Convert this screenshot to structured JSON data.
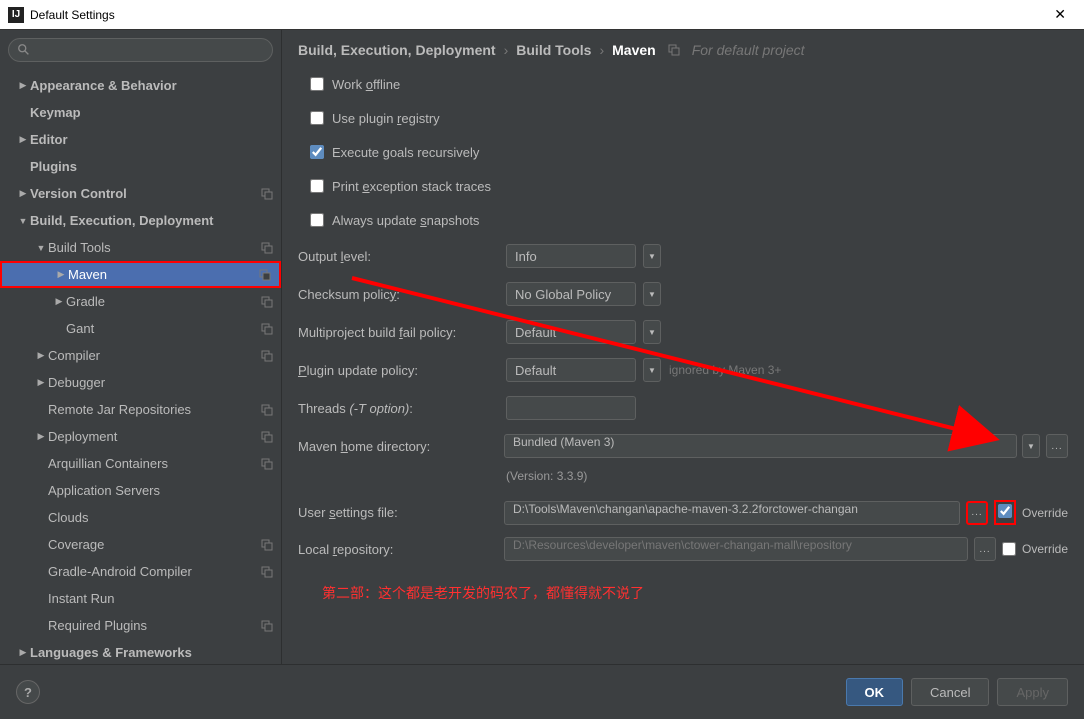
{
  "window": {
    "title": "Default Settings"
  },
  "breadcrumb": {
    "path1": "Build, Execution, Deployment",
    "path2": "Build Tools",
    "current": "Maven",
    "hint": "For default project"
  },
  "sidebar": {
    "items": [
      {
        "label": "Appearance & Behavior",
        "level": 0,
        "arrow": "closed",
        "bold": true
      },
      {
        "label": "Keymap",
        "level": 0,
        "arrow": "",
        "bold": true
      },
      {
        "label": "Editor",
        "level": 0,
        "arrow": "closed",
        "bold": true
      },
      {
        "label": "Plugins",
        "level": 0,
        "arrow": "",
        "bold": true
      },
      {
        "label": "Version Control",
        "level": 0,
        "arrow": "closed",
        "bold": true,
        "copy": true
      },
      {
        "label": "Build, Execution, Deployment",
        "level": 0,
        "arrow": "open",
        "bold": true
      },
      {
        "label": "Build Tools",
        "level": 1,
        "arrow": "open",
        "copy": true
      },
      {
        "label": "Maven",
        "level": 2,
        "arrow": "closed",
        "copy": true,
        "selected": true
      },
      {
        "label": "Gradle",
        "level": 2,
        "arrow": "closed",
        "copy": true
      },
      {
        "label": "Gant",
        "level": 2,
        "arrow": "",
        "copy": true
      },
      {
        "label": "Compiler",
        "level": 1,
        "arrow": "closed",
        "copy": true
      },
      {
        "label": "Debugger",
        "level": 1,
        "arrow": "closed"
      },
      {
        "label": "Remote Jar Repositories",
        "level": 1,
        "arrow": "",
        "copy": true
      },
      {
        "label": "Deployment",
        "level": 1,
        "arrow": "closed",
        "copy": true
      },
      {
        "label": "Arquillian Containers",
        "level": 1,
        "arrow": "",
        "copy": true
      },
      {
        "label": "Application Servers",
        "level": 1,
        "arrow": ""
      },
      {
        "label": "Clouds",
        "level": 1,
        "arrow": ""
      },
      {
        "label": "Coverage",
        "level": 1,
        "arrow": "",
        "copy": true
      },
      {
        "label": "Gradle-Android Compiler",
        "level": 1,
        "arrow": "",
        "copy": true
      },
      {
        "label": "Instant Run",
        "level": 1,
        "arrow": ""
      },
      {
        "label": "Required Plugins",
        "level": 1,
        "arrow": "",
        "copy": true
      },
      {
        "label": "Languages & Frameworks",
        "level": 0,
        "arrow": "closed",
        "bold": true
      }
    ]
  },
  "checks": {
    "work_offline": "Work offline",
    "use_plugin_registry": "Use plugin registry",
    "execute_recursively": "Execute goals recursively",
    "print_exception": "Print exception stack traces",
    "always_update": "Always update snapshots"
  },
  "fields": {
    "output_level": {
      "label": "Output level:",
      "value": "Info"
    },
    "checksum_policy": {
      "label": "Checksum policy:",
      "value": "No Global Policy"
    },
    "multiproject_fail": {
      "label": "Multiproject build fail policy:",
      "value": "Default"
    },
    "plugin_update": {
      "label": "Plugin update policy:",
      "value": "Default",
      "hint": "ignored by Maven 3+"
    },
    "threads": {
      "label": "Threads (-T option)",
      "value": ""
    },
    "maven_home": {
      "label": "Maven home directory:",
      "value": "Bundled (Maven 3)"
    },
    "version": "(Version: 3.3.9)",
    "user_settings": {
      "label": "User settings file:",
      "value": "D:\\Tools\\Maven\\changan\\apache-maven-3.2.2forctower-changan",
      "override": "Override"
    },
    "local_repo": {
      "label": "Local repository:",
      "value": "D:\\Resources\\developer\\maven\\ctower-changan-mall\\repository",
      "override": "Override"
    }
  },
  "annotation": "第二部：这个都是老开发的码农了，都懂得就不说了",
  "footer": {
    "ok": "OK",
    "cancel": "Cancel",
    "apply": "Apply"
  }
}
